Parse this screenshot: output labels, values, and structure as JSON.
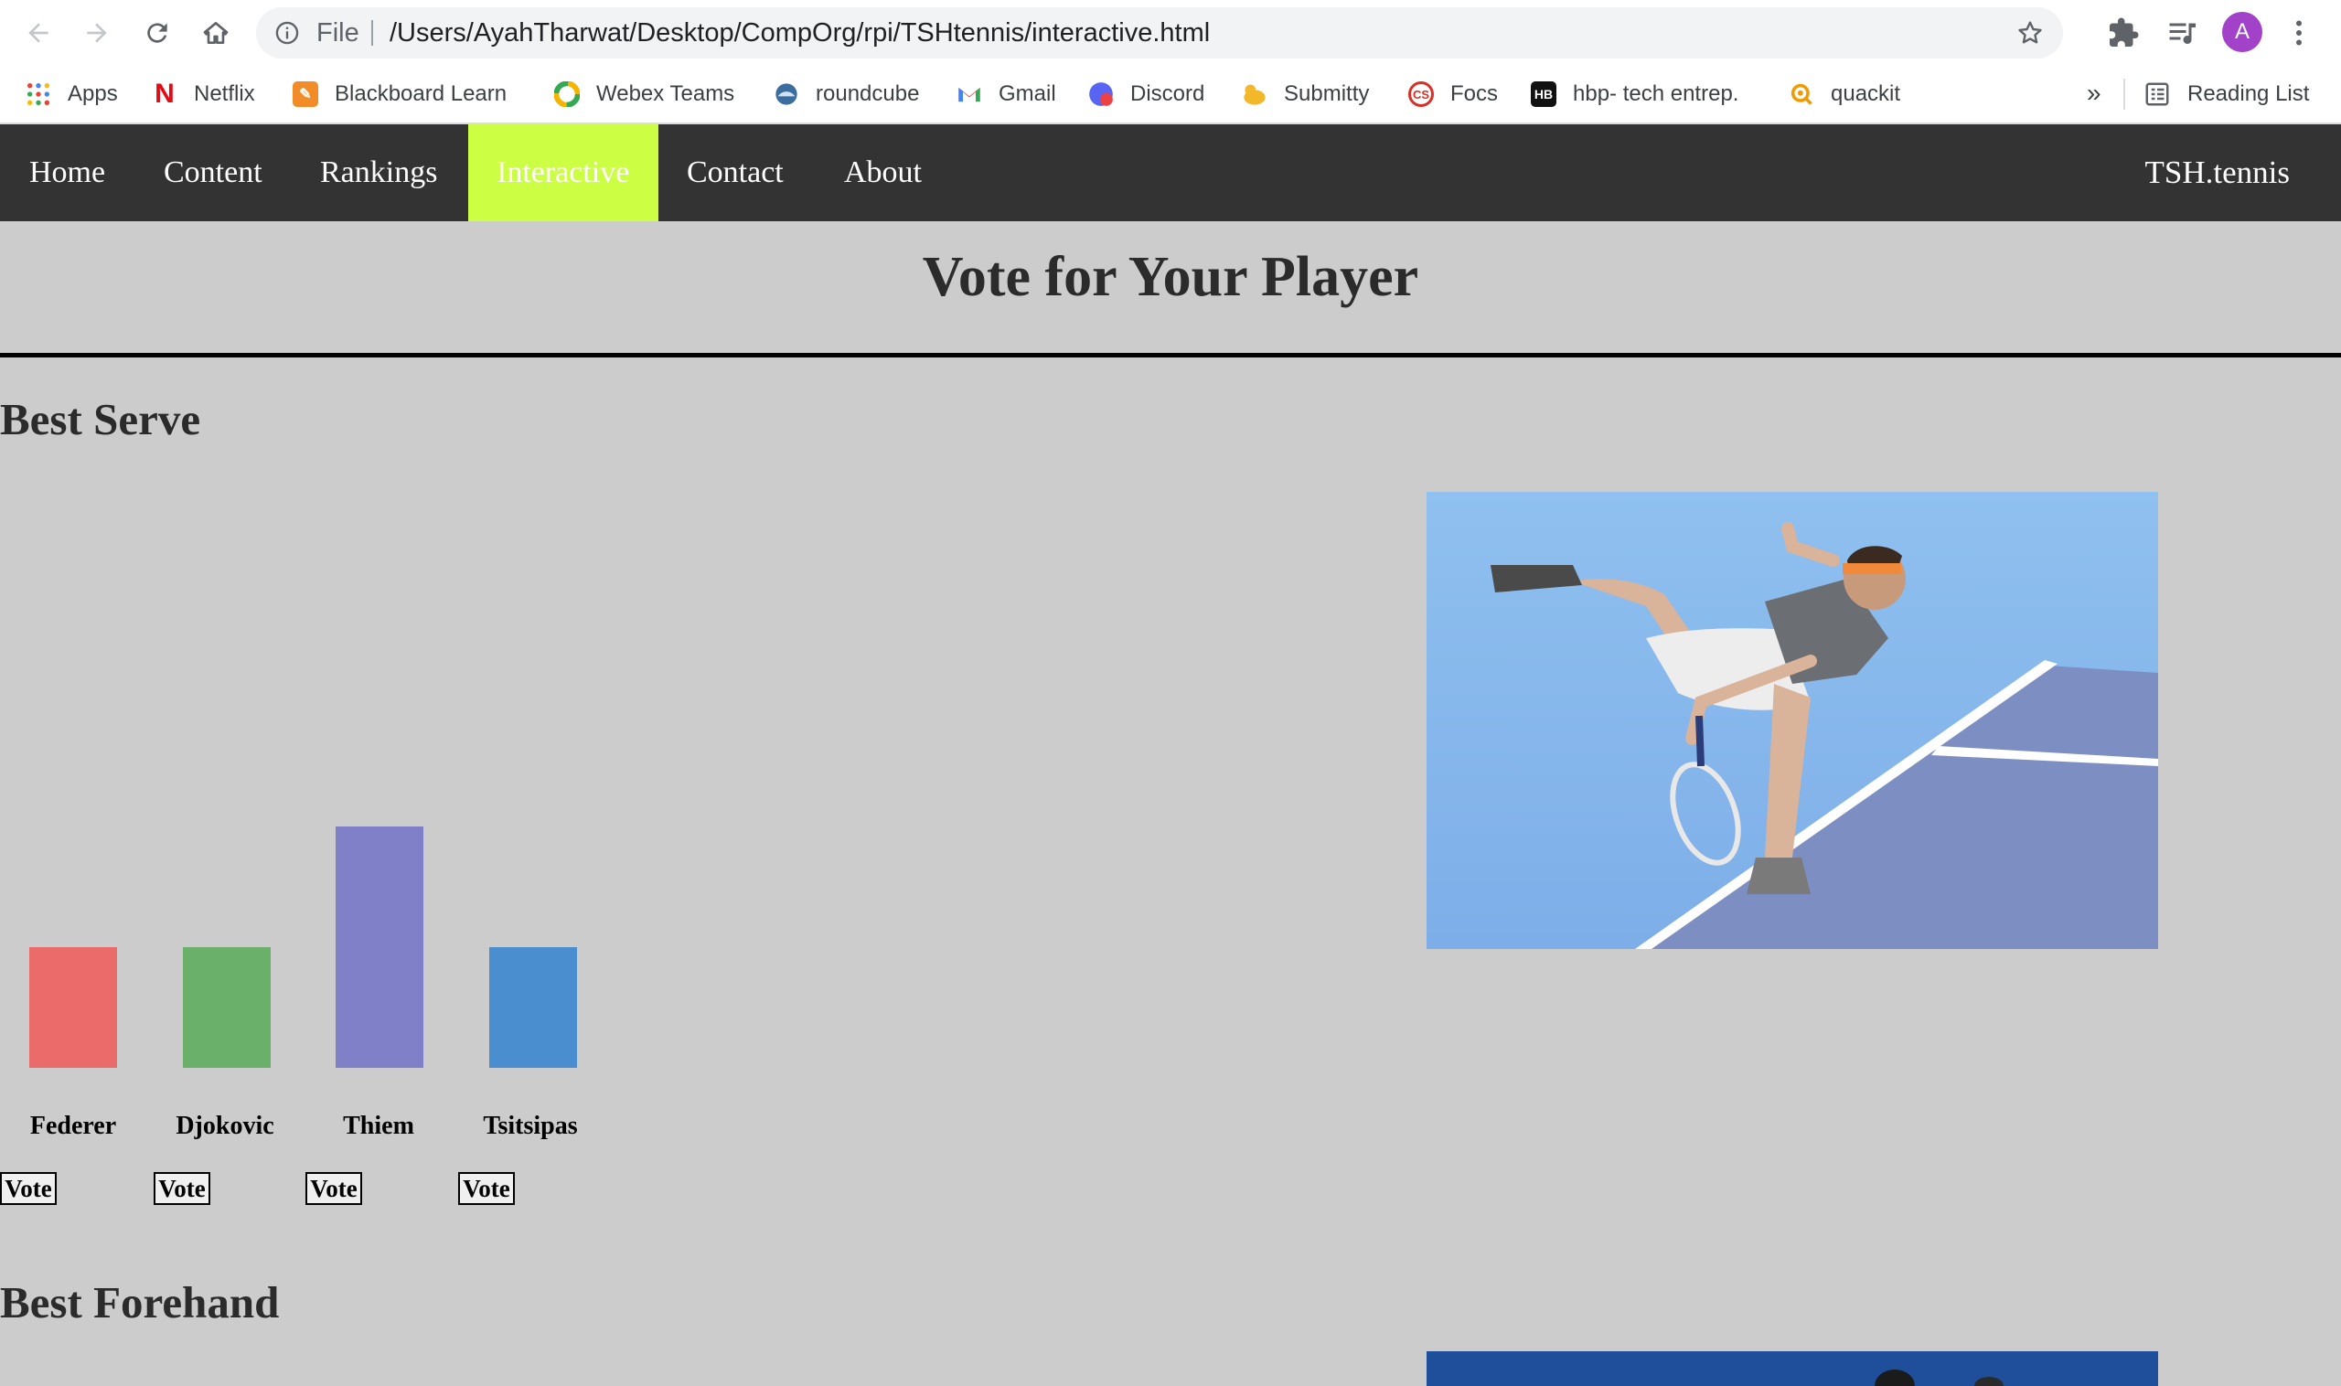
{
  "browser": {
    "omnibox": {
      "scheme_label": "File",
      "url": "/Users/AyahTharwat/Desktop/CompOrg/rpi/TSHtennis/interactive.html"
    },
    "profile_initial": "A",
    "bookmarks": [
      {
        "label": "Apps",
        "icon": "apps-grid-icon"
      },
      {
        "label": "Netflix",
        "icon": "netflix-icon"
      },
      {
        "label": "Blackboard Learn",
        "icon": "blackboard-icon"
      },
      {
        "label": "Webex Teams",
        "icon": "webex-icon"
      },
      {
        "label": "roundcube",
        "icon": "roundcube-icon"
      },
      {
        "label": "Gmail",
        "icon": "gmail-icon"
      },
      {
        "label": "Discord",
        "icon": "discord-icon"
      },
      {
        "label": "Submitty",
        "icon": "submitty-icon"
      },
      {
        "label": "Focs",
        "icon": "focs-icon"
      },
      {
        "label": "hbp- tech entrep.",
        "icon": "hbp-icon"
      },
      {
        "label": "quackit",
        "icon": "quackit-icon"
      }
    ],
    "more_label": "»",
    "reading_list_label": "Reading List"
  },
  "site": {
    "nav": [
      "Home",
      "Content",
      "Rankings",
      "Interactive",
      "Contact",
      "About"
    ],
    "active_nav": "Interactive",
    "active_color": "#ccff44",
    "nav_bg": "#333333",
    "brand": "TSH.tennis",
    "page_title": "Vote for Your Player"
  },
  "sections": [
    {
      "heading": "Best Serve",
      "vote_label": "Vote",
      "players": [
        {
          "name": "Federer",
          "votes": 1,
          "color": "#eb6a6a"
        },
        {
          "name": "Djokovic",
          "votes": 1,
          "color": "#6ab06a"
        },
        {
          "name": "Thiem",
          "votes": 2,
          "color": "#8080c8"
        },
        {
          "name": "Tsitsipas",
          "votes": 1,
          "color": "#4a8ecf"
        }
      ]
    },
    {
      "heading": "Best Forehand"
    }
  ]
}
